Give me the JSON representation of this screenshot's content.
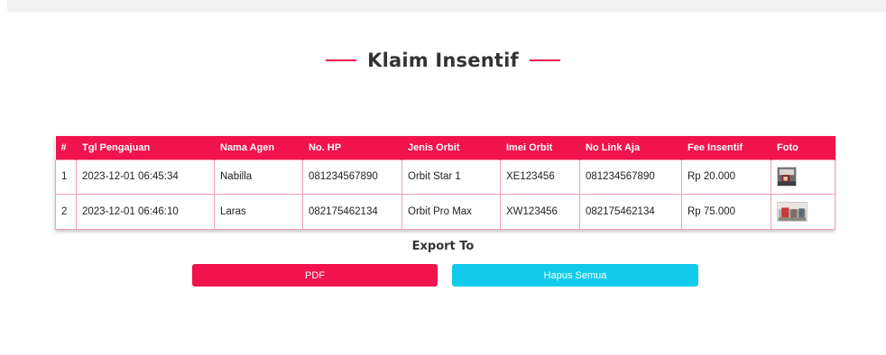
{
  "page": {
    "title": "Klaim Insentif"
  },
  "colors": {
    "accent": "#f0134d",
    "secondary": "#12cbec"
  },
  "table": {
    "headers": [
      "#",
      "Tgl Pengajuan",
      "Nama Agen",
      "No. HP",
      "Jenis Orbit",
      "Imei Orbit",
      "No Link Aja",
      "Fee Insentif",
      "Foto"
    ],
    "rows": [
      {
        "no": "1",
        "tgl": "2023-12-01 06:45:34",
        "nama": "Nabilla",
        "hp": "081234567890",
        "jenis": "Orbit Star 1",
        "imei": "XE123456",
        "linkaja": "081234567890",
        "fee": "Rp 20.000",
        "foto": "photo-thumbnail"
      },
      {
        "no": "2",
        "tgl": "2023-12-01 06:46:10",
        "nama": "Laras",
        "hp": "082175462134",
        "jenis": "Orbit Pro Max",
        "imei": "XW123456",
        "linkaja": "082175462134",
        "fee": "Rp 75.000",
        "foto": "photo-thumbnail"
      }
    ]
  },
  "export": {
    "label": "Export To",
    "pdf_label": "PDF",
    "hapus_label": "Hapus Semua"
  }
}
